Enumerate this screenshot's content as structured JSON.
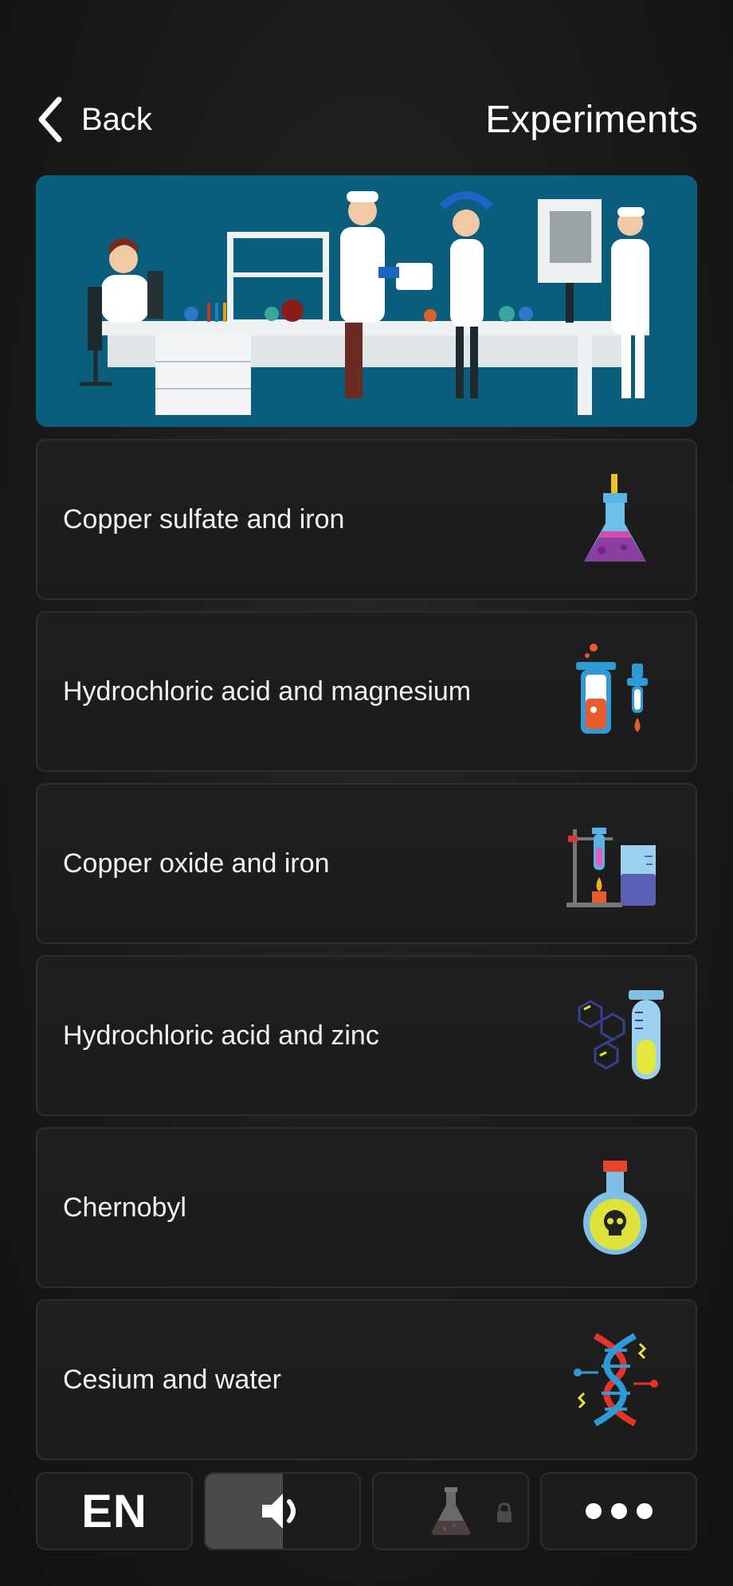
{
  "header": {
    "back_label": "Back",
    "title": "Experiments"
  },
  "experiments": [
    {
      "label": "Copper sulfate and iron",
      "icon": "conical-flask-icon"
    },
    {
      "label": "Hydrochloric acid and magnesium",
      "icon": "test-tube-dropper-icon"
    },
    {
      "label": "Copper oxide and iron",
      "icon": "burner-beaker-icon"
    },
    {
      "label": "Hydrochloric acid and zinc",
      "icon": "molecule-test-tube-icon"
    },
    {
      "label": "Chernobyl",
      "icon": "poison-flask-icon"
    },
    {
      "label": "Cesium and water",
      "icon": "dna-icon"
    }
  ],
  "bottom_bar": {
    "language": "EN",
    "sound_level": 0.5,
    "lab_locked": true
  },
  "colors": {
    "background": "#161616",
    "card_border": "#2e2e2e",
    "banner": "#0b5d7c"
  }
}
